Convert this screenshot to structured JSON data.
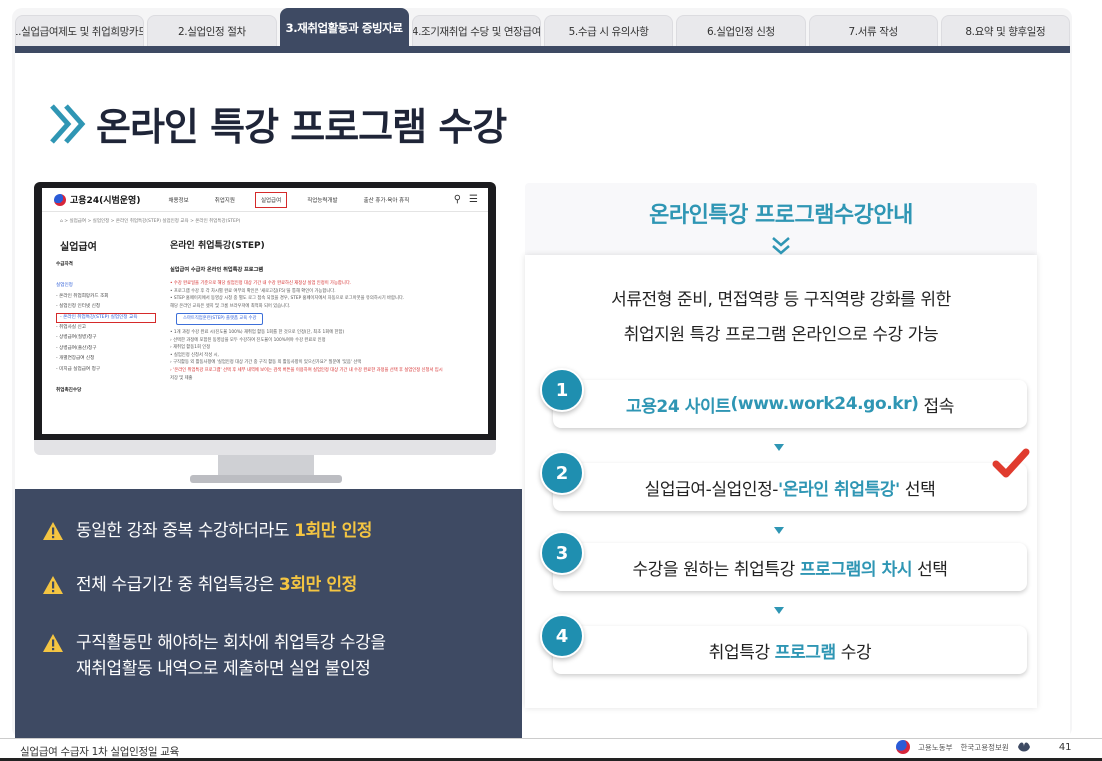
{
  "tabs": [
    {
      "label": "1.실업급여제도 및 취업희망카드",
      "active": false
    },
    {
      "label": "2.실업인정 절차",
      "active": false
    },
    {
      "label": "3.재취업활동과 증빙자료",
      "active": true
    },
    {
      "label": "4.조기재취업 수당 및 연장급여",
      "active": false
    },
    {
      "label": "5.수급 시 유의사항",
      "active": false
    },
    {
      "label": "6.실업인정 신청",
      "active": false
    },
    {
      "label": "7.서류 작성",
      "active": false
    },
    {
      "label": "8.요약 및 향후일정",
      "active": false
    }
  ],
  "page_title": "온라인 특강 프로그램 수강",
  "screenshot": {
    "logo": "고용24(시범운영)",
    "nav": [
      "채용정보",
      "취업지원",
      "실업급여",
      "직업능력개발",
      "출산 휴가·육아 휴직"
    ],
    "nav_highlight_index": 2,
    "breadcrumb": "⌂ > 실업급여 > 실업인정 > 온라인 취업특강(STEP) 실업인정 교육 > 온라인 취업특강(STEP)",
    "side_title": "실업급여",
    "main_title": "온라인 취업특강(STEP)",
    "side_items": [
      {
        "text": "수급자격",
        "style": "b"
      },
      {
        "text": "",
        "style": ""
      },
      {
        "text": "실업인정",
        "style": "blue"
      },
      {
        "text": "- 온라인 취업희망카드 조회",
        "style": ""
      },
      {
        "text": "- 실업인정 인터넷 신청",
        "style": ""
      },
      {
        "text": "- 온라인 취업특강(STEP) 실업인정 교육",
        "style": "hl"
      },
      {
        "text": "- 취업사실 신고",
        "style": ""
      },
      {
        "text": "- 상병급여(질병)청구",
        "style": ""
      },
      {
        "text": "- 상병급여(출산)청구",
        "style": ""
      },
      {
        "text": "- 개별연장급여 신청",
        "style": ""
      },
      {
        "text": "- 미지급 실업급여 청구",
        "style": ""
      },
      {
        "text": "",
        "style": ""
      },
      {
        "text": "취업촉진수당",
        "style": "b"
      }
    ],
    "sub_title": "실업급여 수급자 온라인 취업특강 프로그램",
    "body_lines": [
      {
        "text": "• 수강 완료일을 기준으로 해당 실업인정 대상 기간 내 수강 완료하신 재정상 실업 인정이 가능합니다.",
        "red": true
      },
      {
        "text": "• 프로그램 수강 후 각 차시별 완료 여부의 확인은 '새로고침(F5)'을 통해 확인이 가능합니다.",
        "red": false
      },
      {
        "text": "• STEP 홈페이지에서 동영상 시청 중 별도 로그 접속 되었을 경우, STEP 홈페이지에서 자동으로 로그아웃을 유의하시기 바랍니다.",
        "red": false
      },
      {
        "text": "  해당 온라인 교육은 엣지 및 크롬 브라우저에 최적화 되어 있습니다.",
        "red": false
      }
    ],
    "button_label": "스마트직업훈련(STEP) 플랫폼 교육 수강",
    "body_lines2": [
      {
        "text": "• 1개 과정 수강 완료 시(진도율 100%) 재취업 활동 1회를 한 것으로 인정(단, 최초 1회에 한함)",
        "red": false
      },
      {
        "text": "  › 선택한 과정에 포함된 동영상을 모두 수강하여 진도율이 100%여야 수강 완료로 인정",
        "red": false
      },
      {
        "text": "  › 재취업 활동1회 인정",
        "red": false
      },
      {
        "text": "• 실업인정 신청서 작성 시,",
        "red": false
      },
      {
        "text": "  › 구직활동 외 활동사항에 '실업인정 대상 기간 중 구직 활동 외 활동사항이 있으신가요?' 질문에 '있음' 선택",
        "red": false
      },
      {
        "text": "  › '온라인 취업특강 프로그램' 선택 후 세부 내역에 보이는 검색 버튼을 이용하여 실업인정 대상 기간 내 수강 완료한 과정을 선택 후 실업인정 신청서 입시",
        "red": true
      },
      {
        "text": "    저장 및 제출",
        "red": false
      }
    ]
  },
  "warnings": [
    {
      "before": "동일한 강좌 중복 수강하더라도 ",
      "hl": "1회만 인정",
      "after": ""
    },
    {
      "before": "전체 수급기간 중 취업특강은 ",
      "hl": "3회만 인정",
      "after": ""
    },
    {
      "before": "구직활동만 해야하는 회차에 취업특강 수강을",
      "hl": "",
      "after": "재취업활동 내역으로 제출하면 실업 불인정"
    }
  ],
  "right_panel": {
    "title": "온라인특강 프로그램수강안내",
    "desc_line1": "서류전형 준비, 면접역량 등 구직역량 강화를 위한",
    "desc_line2": "취업지원 특강 프로그램 온라인으로 수강 가능",
    "steps": [
      {
        "num": "1",
        "parts": [
          {
            "t": "고용24 사이트",
            "c": "teal"
          },
          {
            "t": "(www.work24.go.kr)",
            "c": "teal"
          },
          {
            "t": " 접속",
            "c": ""
          }
        ]
      },
      {
        "num": "2",
        "parts": [
          {
            "t": "실업급여-실업인정-",
            "c": ""
          },
          {
            "t": "'온라인 취업특강'",
            "c": "teal"
          },
          {
            "t": " 선택",
            "c": ""
          }
        ]
      },
      {
        "num": "3",
        "parts": [
          {
            "t": "수강을 원하는 취업특강 ",
            "c": ""
          },
          {
            "t": "프로그램의 차시",
            "c": "teal"
          },
          {
            "t": " 선택",
            "c": ""
          }
        ]
      },
      {
        "num": "4",
        "parts": [
          {
            "t": "취업특강 ",
            "c": ""
          },
          {
            "t": "프로그램",
            "c": "teal"
          },
          {
            "t": " 수강",
            "c": ""
          }
        ]
      }
    ]
  },
  "footer": {
    "left": "실업급여 수급자 1차 실업인정일 교육",
    "org1": "고용노동부",
    "org2": "한국고용정보원",
    "page": "41"
  },
  "colors": {
    "navy": "#3e4a63",
    "teal": "#2f96b4",
    "highlight_yellow": "#f4c542",
    "alert_red": "#d52a2a"
  }
}
